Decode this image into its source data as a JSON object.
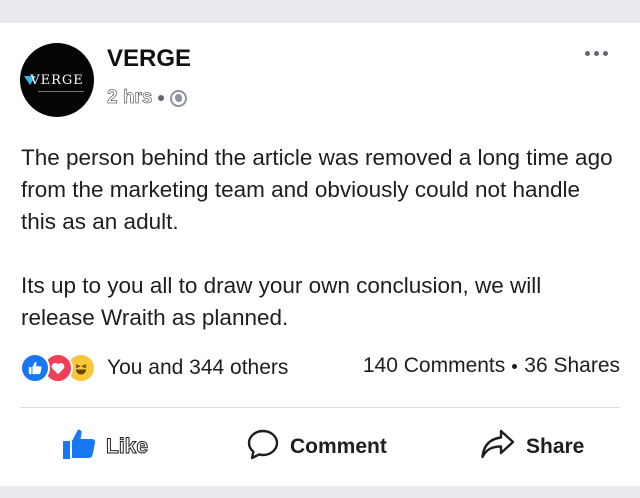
{
  "post": {
    "page_name": "VERGE",
    "avatar_text": "VERGE",
    "timestamp": "2 hrs",
    "privacy_icon": "globe-icon",
    "more_icon": "ellipsis-icon",
    "paragraphs": [
      "The person behind the article was removed a long time ago from the marketing team and obviously could not handle this as an adult.",
      "Its up to you all to draw your own conclusion, we will release Wraith as planned."
    ]
  },
  "engagement": {
    "reaction_icons": [
      "like-reaction-icon",
      "love-reaction-icon",
      "haha-reaction-icon"
    ],
    "reactions_text": "You and 344 others",
    "comments": "140 Comments",
    "shares": "36 Shares"
  },
  "actions": {
    "like": "Like",
    "comment": "Comment",
    "share": "Share"
  },
  "colors": {
    "like_blue": "#1877f2",
    "love_red": "#f33e58",
    "haha_yellow": "#f7c73a",
    "background": "#e9ebee"
  }
}
